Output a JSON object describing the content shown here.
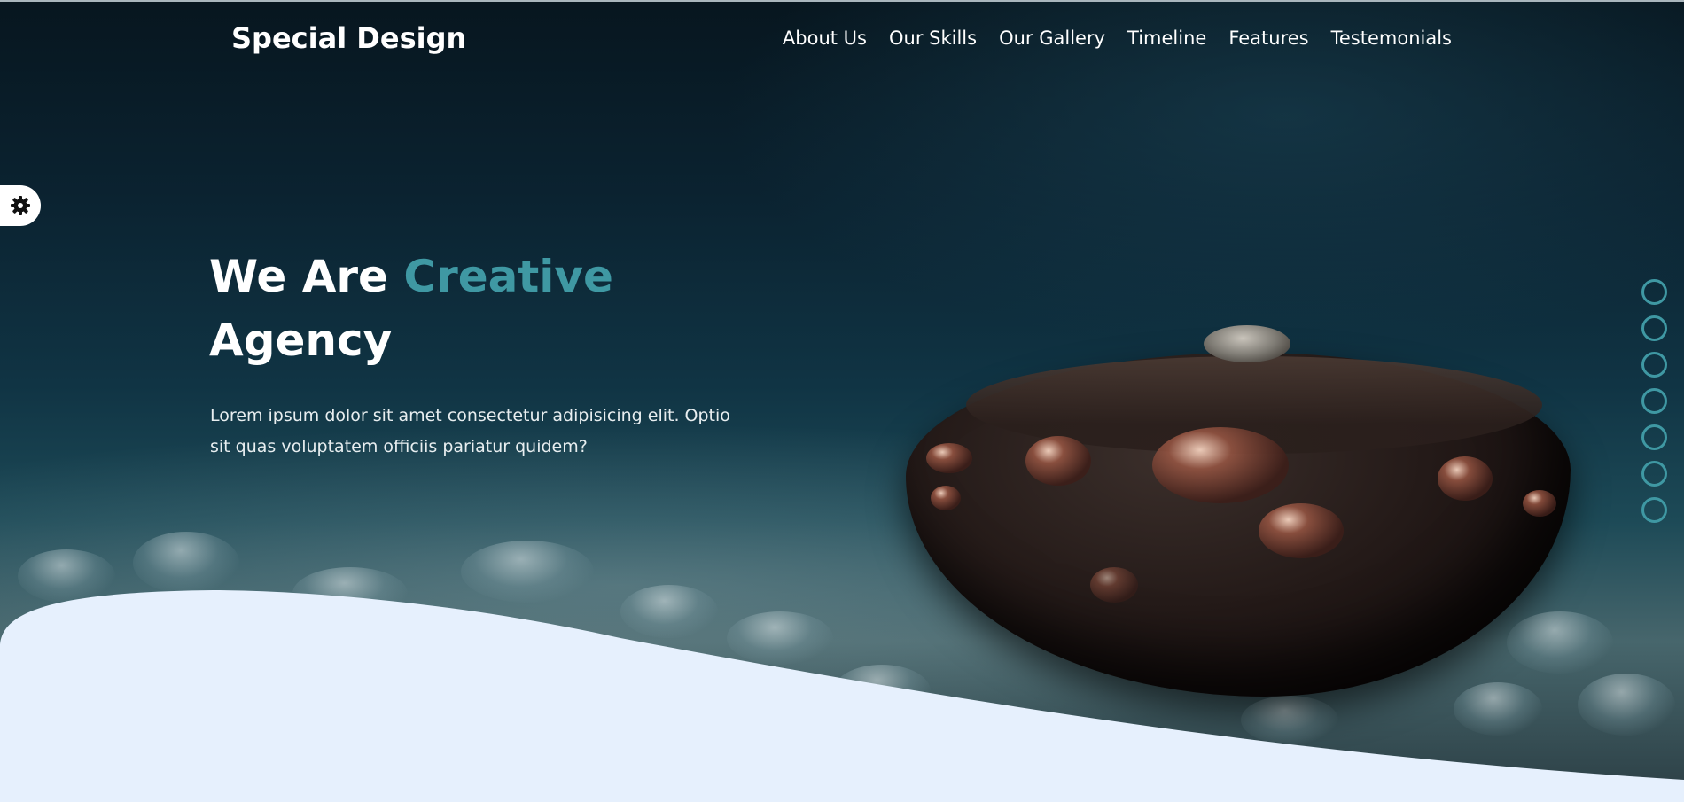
{
  "site": {
    "logo": "Special Design",
    "nav": [
      "About Us",
      "Our Skills",
      "Our Gallery",
      "Timeline",
      "Features",
      "Testemonials"
    ]
  },
  "hero": {
    "heading_before": "We Are ",
    "heading_accent": "Creative",
    "heading_after": "Agency",
    "description": "Lorem ipsum dolor sit amet consectetur adipisicing elit. Optio sit quas voluptatem officiis pariatur quidem?"
  },
  "settings": {
    "icon": "gear-icon"
  },
  "page_bullets": {
    "count": 7
  },
  "colors": {
    "accent": "#3f98a3",
    "wave": "#e6f0fd",
    "text": "#ffffff"
  }
}
